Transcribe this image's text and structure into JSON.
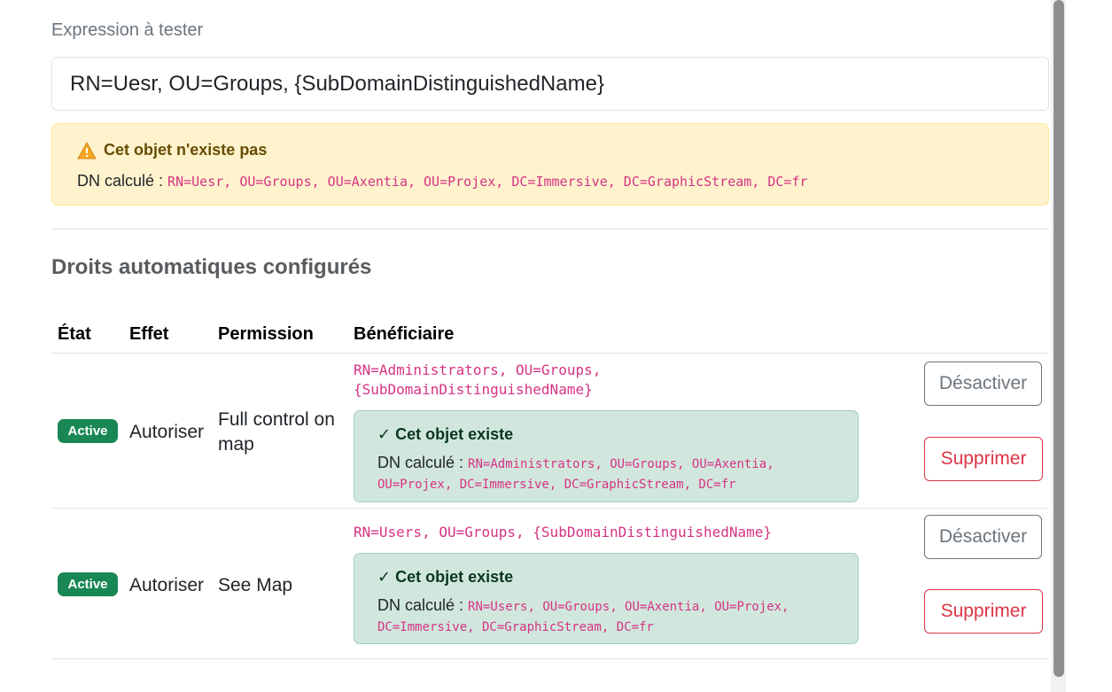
{
  "tester": {
    "label": "Expression à tester",
    "input_value": "RN=Uesr, OU=Groups, {SubDomainDistinguishedName}",
    "warning_title": "Cet objet n'existe pas",
    "dn_label": "DN calculé :",
    "dn_value": "RN=Uesr, OU=Groups, OU=Axentia, OU=Projex, DC=Immersive, DC=GraphicStream, DC=fr"
  },
  "rights": {
    "section_title": "Droits automatiques configurés",
    "headers": [
      "État",
      "Effet",
      "Permission",
      "Bénéficiaire"
    ],
    "rows": [
      {
        "state": "Active",
        "effect": "Autoriser",
        "permission": "Full control on map",
        "beneficiary": "RN=Administrators, OU=Groups, {SubDomainDistinguishedName}",
        "status_title": "✓ Cet objet existe",
        "dn_label": "DN calculé :",
        "dn_value": "RN=Administrators, OU=Groups, OU=Axentia, OU=Projex, DC=Immersive, DC=GraphicStream, DC=fr",
        "deactivate_label": "Désactiver",
        "delete_label": "Supprimer"
      },
      {
        "state": "Active",
        "effect": "Autoriser",
        "permission": "See Map",
        "beneficiary": "RN=Users, OU=Groups, {SubDomainDistinguishedName}",
        "status_title": "✓ Cet objet existe",
        "dn_label": "DN calculé :",
        "dn_value": "RN=Users, OU=Groups, OU=Axentia, OU=Projex, DC=Immersive, DC=GraphicStream, DC=fr",
        "deactivate_label": "Désactiver",
        "delete_label": "Supprimer"
      }
    ]
  },
  "colors": {
    "success": "#198754",
    "warning_bg": "#fff3cd",
    "success_bg": "#d1e7dd",
    "danger": "#dc3545",
    "code": "#d63384"
  },
  "icons": {
    "warning": "warning-triangle-icon"
  }
}
